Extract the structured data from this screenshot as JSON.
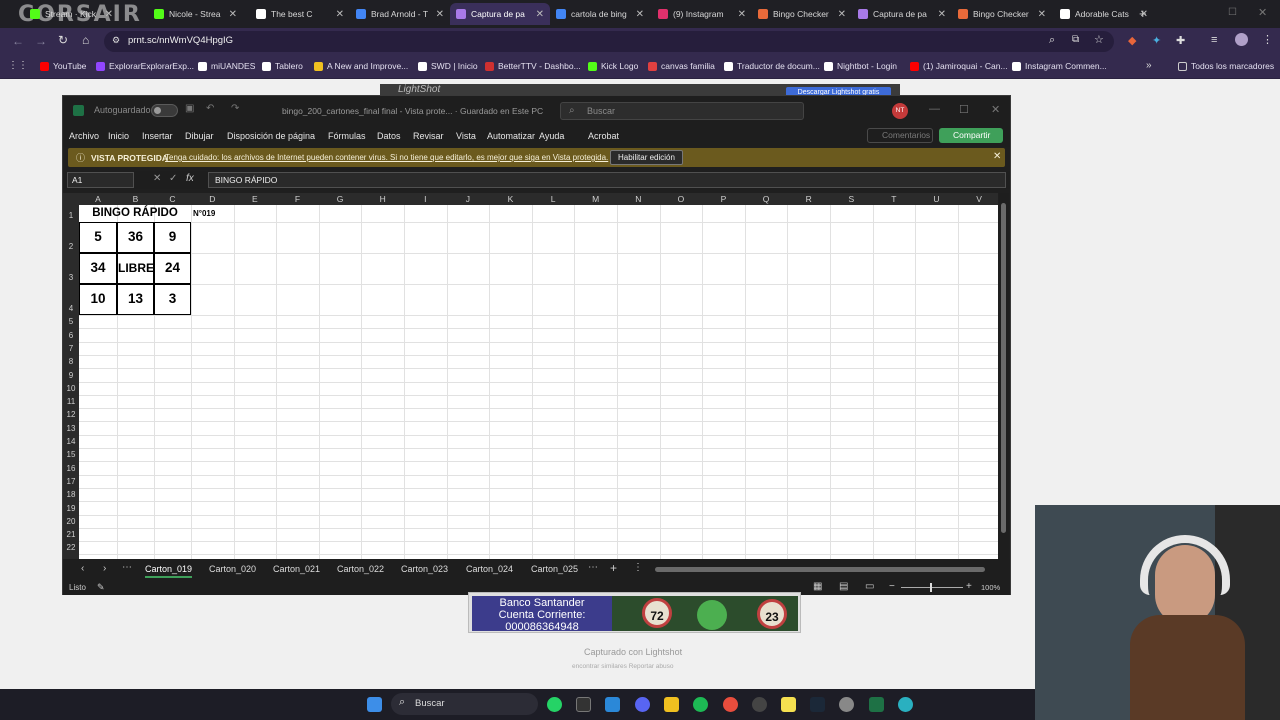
{
  "browser": {
    "brand": "CORSAIR",
    "tabs": [
      {
        "title": "Stream · Kick",
        "color": "#53fc18"
      },
      {
        "title": "Nicole - Strea",
        "color": "#53fc18"
      },
      {
        "title": "The best C",
        "color": "#ffffff"
      },
      {
        "title": "Brad Arnold - T",
        "color": "#4285f4"
      },
      {
        "title": "Captura de pa",
        "color": "#a87ae8"
      },
      {
        "title": "cartola de bing",
        "color": "#4285f4"
      },
      {
        "title": "(9) Instagram",
        "color": "#e1306c"
      },
      {
        "title": "Bingo Checker",
        "color": "#e86a3a"
      },
      {
        "title": "Captura de pa",
        "color": "#a87ae8"
      },
      {
        "title": "Bingo Checker",
        "color": "#e86a3a"
      },
      {
        "title": "Adorable Cats",
        "color": "#ffffff"
      }
    ],
    "url": "prnt.sc/nnWmVQ4HpgIG",
    "bookmarks": [
      {
        "label": "YouTube",
        "color": "#ff0000"
      },
      {
        "label": "ExplorarExplorarExp...",
        "color": "#9146ff"
      },
      {
        "label": "miUANDES",
        "color": "#ffffff"
      },
      {
        "label": "Tablero",
        "color": "#ffffff"
      },
      {
        "label": "A New and Improve...",
        "color": "#f0c020"
      },
      {
        "label": "SWD | Inicio",
        "color": "#ffffff"
      },
      {
        "label": "BetterTTV - Dashbo...",
        "color": "#d03030"
      },
      {
        "label": "Kick Logo",
        "color": "#53fc18"
      },
      {
        "label": "canvas familia",
        "color": "#e04040"
      },
      {
        "label": "Traductor de docum...",
        "color": "#ffffff"
      },
      {
        "label": "Nightbot - Login",
        "color": "#ffffff"
      },
      {
        "label": "(1) Jamiroquai - Can...",
        "color": "#ff0000"
      },
      {
        "label": "Instagram Commen...",
        "color": "#ffffff"
      }
    ],
    "all_bookmarks": "Todos los marcadores",
    "lightshot": "LightShot",
    "download_btn": "Descargar Lightshot gratis"
  },
  "excel": {
    "autosave": "Autoguardado",
    "filename": "bingo_200_cartones_final final  -  Vista prote...  ·  Guardado en Este PC",
    "search_placeholder": "Buscar",
    "avatar": "NT",
    "menus": [
      "Archivo",
      "Inicio",
      "Insertar",
      "Dibujar",
      "Disposición de página",
      "Fórmulas",
      "Datos",
      "Revisar",
      "Vista",
      "Automatizar",
      "Ayuda",
      "Acrobat"
    ],
    "comments": "Comentarios",
    "share": "Compartir",
    "protected_title": "VISTA PROTEGIDA",
    "protected_msg": "Tenga cuidado: los archivos de Internet pueden contener virus. Si no tiene que editarlo, es mejor que siga en Vista protegida.",
    "enable_editing": "Habilitar edición",
    "namebox": "A1",
    "formula": "BINGO RÁPIDO",
    "columns": [
      "A",
      "B",
      "C",
      "D",
      "E",
      "F",
      "G",
      "H",
      "I",
      "J",
      "K",
      "L",
      "M",
      "N",
      "O",
      "P",
      "Q",
      "R",
      "S",
      "T",
      "U",
      "V"
    ],
    "rows": [
      "1",
      "2",
      "3",
      "4",
      "5",
      "6",
      "7",
      "8",
      "9",
      "10",
      "11",
      "12",
      "13",
      "14",
      "15",
      "16",
      "17",
      "18",
      "19",
      "20",
      "21",
      "22"
    ],
    "card": {
      "title": "BINGO RÁPIDO",
      "number": "N°019",
      "cells": [
        [
          "5",
          "36",
          "9"
        ],
        [
          "34",
          "LIBRE",
          "24"
        ],
        [
          "10",
          "13",
          "3"
        ]
      ]
    },
    "sheets": [
      "Carton_019",
      "Carton_020",
      "Carton_021",
      "Carton_022",
      "Carton_023",
      "Carton_024",
      "Carton_025"
    ],
    "active_sheet": "Carton_019",
    "status": "Listo",
    "zoom": "100%"
  },
  "page": {
    "banner_text": "Banco Santander\nCuenta Corriente:\n000086364948",
    "balls": [
      "72",
      "23"
    ],
    "captured": "Capturado con Lightshot",
    "similar": "encontrar similares   Reportar abuso"
  },
  "taskbar": {
    "search": "Buscar"
  }
}
